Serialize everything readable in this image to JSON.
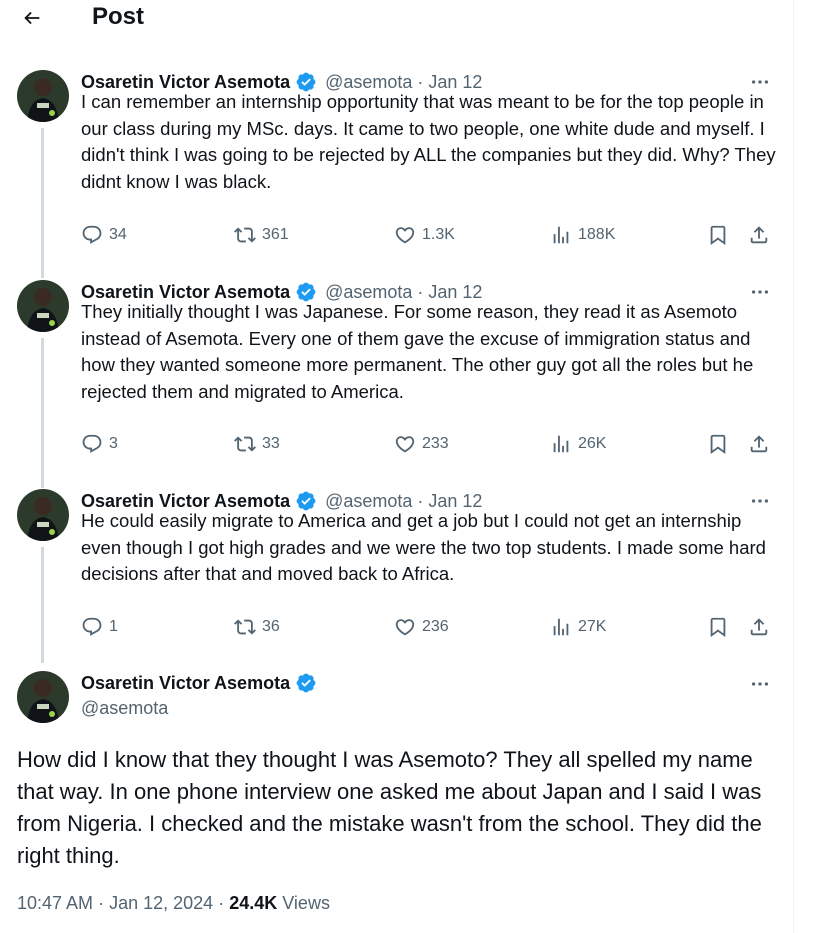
{
  "header": {
    "title": "Post"
  },
  "author": {
    "name": "Osaretin Victor Asemota",
    "handle": "@asemota"
  },
  "colors": {
    "verified": "#1d9bf0",
    "text": "#0f1419",
    "muted": "#536471",
    "thread_line": "#cfd9de"
  },
  "thread": [
    {
      "date": "Jan 12",
      "text": "I can remember an internship opportunity that was meant to be for the top people in our class during my MSc. days. It came to two people, one white dude and myself. I didn't think I was going to be rejected by ALL the companies but they did. Why? They didnt know I was black.",
      "replies": "34",
      "reposts": "361",
      "likes": "1.3K",
      "views": "188K"
    },
    {
      "date": "Jan 12",
      "text": "They initially thought I was Japanese. For some reason, they read it as Asemoto instead of Asemota. Every one of them gave the excuse of immigration status and how they wanted someone more permanent. The other guy got all the roles but he rejected them and migrated to America.",
      "replies": "3",
      "reposts": "33",
      "likes": "233",
      "views": "26K"
    },
    {
      "date": "Jan 12",
      "text": "He could easily migrate to America and get a job but I could not get an internship even though I got high grades and we were the two top students. I made some hard decisions after that and moved back to Africa.",
      "replies": "1",
      "reposts": "36",
      "likes": "236",
      "views": "27K"
    }
  ],
  "main": {
    "text": "How did I know that they thought I was Asemoto? They all spelled my name that way. In one phone interview one asked me about Japan and I said I was from Nigeria. I checked and the mistake wasn't from the school. They did the right thing.",
    "time": "10:47 AM",
    "date": "Jan 12, 2024",
    "views_count": "24.4K",
    "views_label": "Views"
  },
  "icons": [
    "back-arrow-icon",
    "verified-badge-icon",
    "more-icon",
    "reply-icon",
    "repost-icon",
    "like-icon",
    "views-icon",
    "bookmark-icon",
    "share-icon"
  ]
}
